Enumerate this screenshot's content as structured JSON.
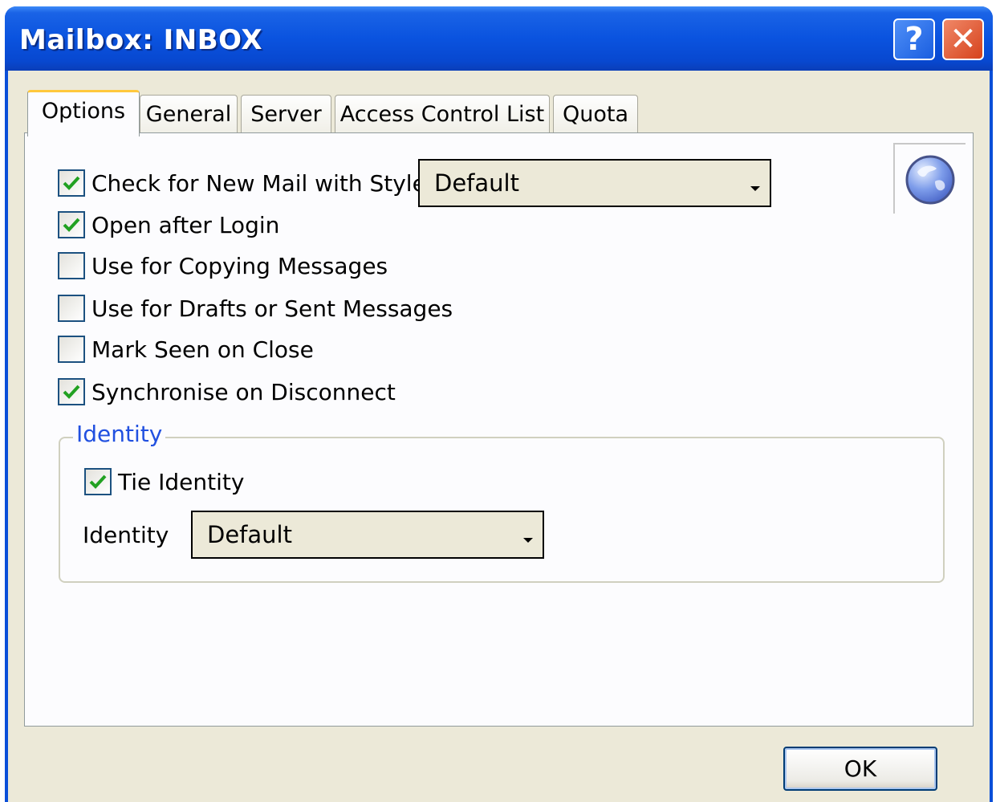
{
  "window": {
    "title": "Mailbox: INBOX",
    "help_glyph": "?",
    "close_glyph": "✕"
  },
  "tabs": [
    {
      "label": "Options",
      "active": true
    },
    {
      "label": "General",
      "active": false
    },
    {
      "label": "Server",
      "active": false
    },
    {
      "label": "Access Control List",
      "active": false
    },
    {
      "label": "Quota",
      "active": false
    }
  ],
  "options": {
    "check_new_mail": {
      "label": "Check for New Mail with Style:",
      "checked": true
    },
    "check_style_select": {
      "value": "Default"
    },
    "open_after_login": {
      "label": "Open after Login",
      "checked": true
    },
    "use_for_copying": {
      "label": "Use for Copying Messages",
      "checked": false
    },
    "use_for_drafts": {
      "label": "Use for Drafts or Sent Messages",
      "checked": false
    },
    "mark_seen": {
      "label": "Mark Seen on Close",
      "checked": false
    },
    "synchronise": {
      "label": "Synchronise on Disconnect",
      "checked": true
    }
  },
  "identity_group": {
    "legend": "Identity",
    "tie_identity": {
      "label": "Tie Identity",
      "checked": true
    },
    "identity_label": "Identity",
    "identity_select": {
      "value": "Default"
    }
  },
  "footer": {
    "ok_label": "OK"
  },
  "icons": {
    "globe": "globe-icon",
    "check": "check-icon"
  },
  "colors": {
    "titlebar": "#0a53df",
    "dialog_bg": "#ece9d8",
    "panel_bg": "#fcfcfe",
    "active_tab_accent": "#ffc83c",
    "group_legend": "#2150e0",
    "checkmark": "#21a121",
    "close_button": "#d6421c"
  }
}
